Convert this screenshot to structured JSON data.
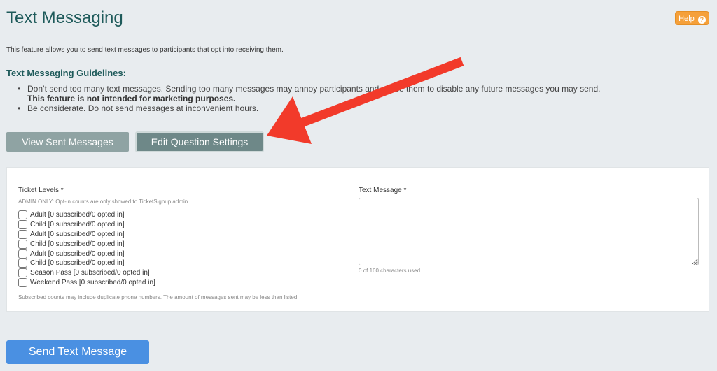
{
  "header": {
    "title": "Text Messaging",
    "help_label": "Help",
    "help_icon": "question-circle-icon"
  },
  "intro": "This feature allows you to send text messages to participants that opt into receiving them.",
  "guidelines": {
    "title": "Text Messaging Guidelines:",
    "items": [
      {
        "text": "Don’t send too many text messages. Sending too many messages may annoy participants and cause them to disable any future messages you may send.",
        "strong": "This feature is not intended for marketing purposes."
      },
      {
        "text": "Be considerate. Do not send messages at inconvenient hours."
      }
    ]
  },
  "buttons": {
    "view_sent": "View Sent Messages",
    "edit_question": "Edit Question Settings",
    "send": "Send Text Message"
  },
  "form": {
    "ticket_levels_label": "Ticket Levels *",
    "admin_note": "ADMIN ONLY: Opt-in counts are only showed to TicketSignup admin.",
    "ticket_levels": [
      "Adult [0 subscribed/0 opted in]",
      "Child [0 subscribed/0 opted in]",
      "Adult [0 subscribed/0 opted in]",
      "Child [0 subscribed/0 opted in]",
      "Adult [0 subscribed/0 opted in]",
      "Child [0 subscribed/0 opted in]",
      "Season Pass [0 subscribed/0 opted in]",
      "Weekend Pass [0 subscribed/0 opted in]"
    ],
    "subscribed_note": "Subscribed counts may include duplicate phone numbers. The amount of messages sent may be less than listed.",
    "text_message_label": "Text Message *",
    "text_message_value": "",
    "char_count": "0 of 160 characters used."
  },
  "colors": {
    "title": "#1e5a5a",
    "help": "#f5a03a",
    "send": "#4a90e2",
    "annotation_arrow": "#f23a2a"
  }
}
